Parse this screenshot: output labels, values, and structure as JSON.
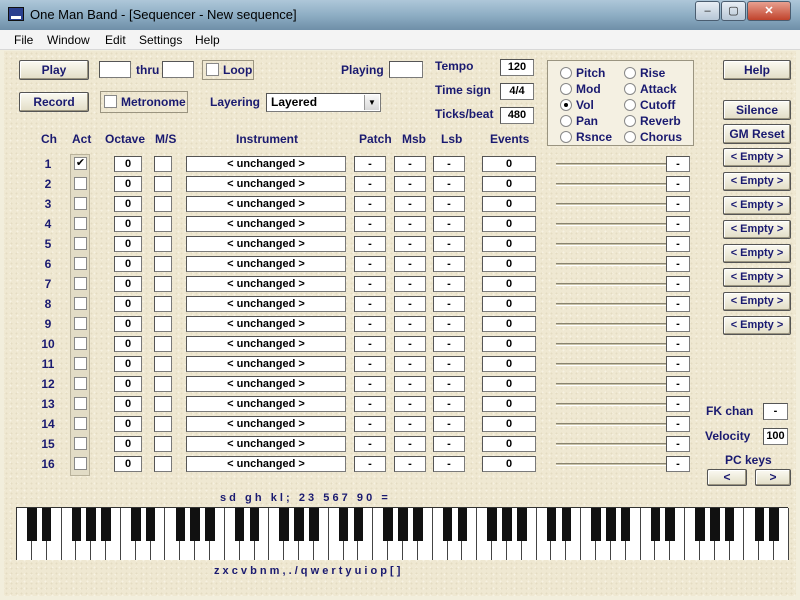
{
  "title": "One Man Band - [Sequencer - New sequence]",
  "window_buttons": {
    "minimize": "–",
    "maximize": "▢",
    "close": "✕"
  },
  "menu": [
    "File",
    "Window",
    "Edit",
    "Settings",
    "Help"
  ],
  "transport": {
    "play": "Play",
    "thru": "thru",
    "from_value": "",
    "thru_value": "",
    "loop_label": "Loop",
    "playing_label": "Playing",
    "playing_value": "",
    "record": "Record",
    "metronome_label": "Metronome",
    "layering_label": "Layering",
    "layering_value": "Layered"
  },
  "tempo": {
    "label": "Tempo",
    "value": "120"
  },
  "time_sign": {
    "label": "Time sign",
    "value": "4/4"
  },
  "ticks": {
    "label": "Ticks/beat",
    "value": "480"
  },
  "controller_options": [
    {
      "label": "Pitch",
      "selected": false
    },
    {
      "label": "Mod",
      "selected": false
    },
    {
      "label": "Vol",
      "selected": true
    },
    {
      "label": "Pan",
      "selected": false
    },
    {
      "label": "Rsnce",
      "selected": false
    },
    {
      "label": "Rise",
      "selected": false
    },
    {
      "label": "Attack",
      "selected": false
    },
    {
      "label": "Cutoff",
      "selected": false
    },
    {
      "label": "Reverb",
      "selected": false
    },
    {
      "label": "Chorus",
      "selected": false
    }
  ],
  "right_buttons": {
    "help": "Help",
    "silence": "Silence",
    "gm_reset": "GM Reset",
    "presets": [
      "< Empty >",
      "< Empty >",
      "< Empty >",
      "< Empty >",
      "< Empty >",
      "< Empty >",
      "< Empty >",
      "< Empty >"
    ]
  },
  "headers": {
    "ch": "Ch",
    "act": "Act",
    "octave": "Octave",
    "ms": "M/S",
    "instrument": "Instrument",
    "patch": "Patch",
    "msb": "Msb",
    "lsb": "Lsb",
    "events": "Events"
  },
  "channels": [
    {
      "ch": "1",
      "act": "✔",
      "octave": "0",
      "instrument": "< unchanged >",
      "patch": "-",
      "msb": "-",
      "lsb": "-",
      "events": "0",
      "ctl": "-"
    },
    {
      "ch": "2",
      "act": "",
      "octave": "0",
      "instrument": "< unchanged >",
      "patch": "-",
      "msb": "-",
      "lsb": "-",
      "events": "0",
      "ctl": "-"
    },
    {
      "ch": "3",
      "act": "",
      "octave": "0",
      "instrument": "< unchanged >",
      "patch": "-",
      "msb": "-",
      "lsb": "-",
      "events": "0",
      "ctl": "-"
    },
    {
      "ch": "4",
      "act": "",
      "octave": "0",
      "instrument": "< unchanged >",
      "patch": "-",
      "msb": "-",
      "lsb": "-",
      "events": "0",
      "ctl": "-"
    },
    {
      "ch": "5",
      "act": "",
      "octave": "0",
      "instrument": "< unchanged >",
      "patch": "-",
      "msb": "-",
      "lsb": "-",
      "events": "0",
      "ctl": "-"
    },
    {
      "ch": "6",
      "act": "",
      "octave": "0",
      "instrument": "< unchanged >",
      "patch": "-",
      "msb": "-",
      "lsb": "-",
      "events": "0",
      "ctl": "-"
    },
    {
      "ch": "7",
      "act": "",
      "octave": "0",
      "instrument": "< unchanged >",
      "patch": "-",
      "msb": "-",
      "lsb": "-",
      "events": "0",
      "ctl": "-"
    },
    {
      "ch": "8",
      "act": "",
      "octave": "0",
      "instrument": "< unchanged >",
      "patch": "-",
      "msb": "-",
      "lsb": "-",
      "events": "0",
      "ctl": "-"
    },
    {
      "ch": "9",
      "act": "",
      "octave": "0",
      "instrument": "< unchanged >",
      "patch": "-",
      "msb": "-",
      "lsb": "-",
      "events": "0",
      "ctl": "-"
    },
    {
      "ch": "10",
      "act": "",
      "octave": "0",
      "instrument": "< unchanged >",
      "patch": "-",
      "msb": "-",
      "lsb": "-",
      "events": "0",
      "ctl": "-"
    },
    {
      "ch": "11",
      "act": "",
      "octave": "0",
      "instrument": "< unchanged >",
      "patch": "-",
      "msb": "-",
      "lsb": "-",
      "events": "0",
      "ctl": "-"
    },
    {
      "ch": "12",
      "act": "",
      "octave": "0",
      "instrument": "< unchanged >",
      "patch": "-",
      "msb": "-",
      "lsb": "-",
      "events": "0",
      "ctl": "-"
    },
    {
      "ch": "13",
      "act": "",
      "octave": "0",
      "instrument": "< unchanged >",
      "patch": "-",
      "msb": "-",
      "lsb": "-",
      "events": "0",
      "ctl": "-"
    },
    {
      "ch": "14",
      "act": "",
      "octave": "0",
      "instrument": "< unchanged >",
      "patch": "-",
      "msb": "-",
      "lsb": "-",
      "events": "0",
      "ctl": "-"
    },
    {
      "ch": "15",
      "act": "",
      "octave": "0",
      "instrument": "< unchanged >",
      "patch": "-",
      "msb": "-",
      "lsb": "-",
      "events": "0",
      "ctl": "-"
    },
    {
      "ch": "16",
      "act": "",
      "octave": "0",
      "instrument": "< unchanged >",
      "patch": "-",
      "msb": "-",
      "lsb": "-",
      "events": "0",
      "ctl": "-"
    }
  ],
  "fk_chan": {
    "label": "FK chan",
    "value": "-"
  },
  "velocity": {
    "label": "Velocity",
    "value": "100"
  },
  "pc_keys": {
    "label": "PC keys",
    "left": "<",
    "right": ">"
  },
  "keyboard_labels": {
    "top": "s d   g h   k l ;   2 3   5 6 7   9 0   =",
    "bottom": "z x c v b n m , . / q w e r t y u i o p [ ]"
  }
}
